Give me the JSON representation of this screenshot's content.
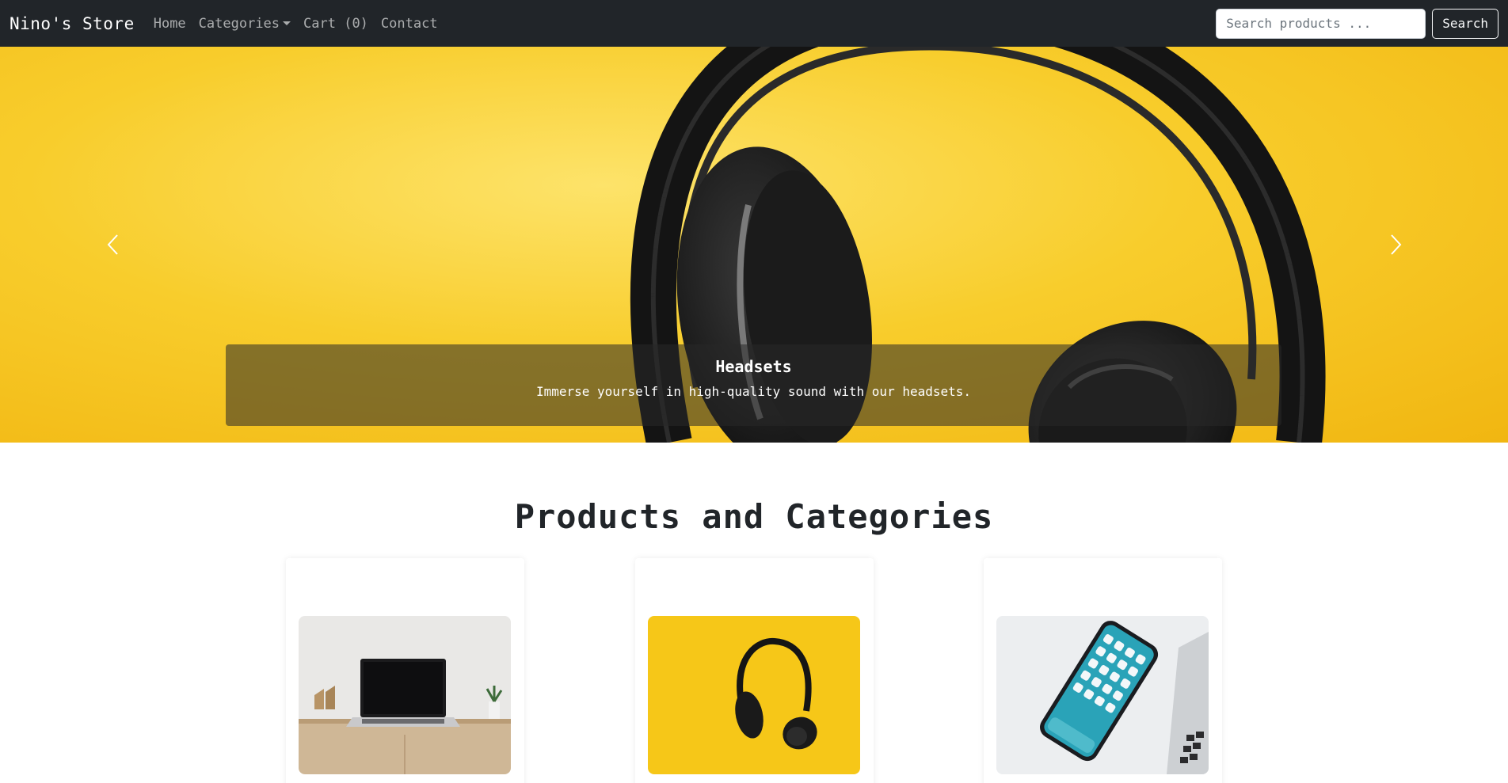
{
  "navbar": {
    "brand": "Nino's Store",
    "links": [
      {
        "label": "Home"
      },
      {
        "label": "Categories"
      },
      {
        "label": "Cart (0)"
      },
      {
        "label": "Contact"
      }
    ],
    "search": {
      "placeholder": "Search products ...",
      "value": "",
      "button_label": "Search"
    }
  },
  "carousel": {
    "active_slide": {
      "title": "Headsets",
      "text": "Immerse yourself in high-quality sound with our headsets."
    },
    "prev_icon": "chevron-left-icon",
    "next_icon": "chevron-right-icon"
  },
  "products_section": {
    "title": "Products and Categories",
    "cards": [
      {
        "image": "laptop"
      },
      {
        "image": "headphones"
      },
      {
        "image": "smartphone"
      }
    ]
  },
  "colors": {
    "navbar_bg": "#212529",
    "hero_yellow": "#f8cd2c"
  }
}
